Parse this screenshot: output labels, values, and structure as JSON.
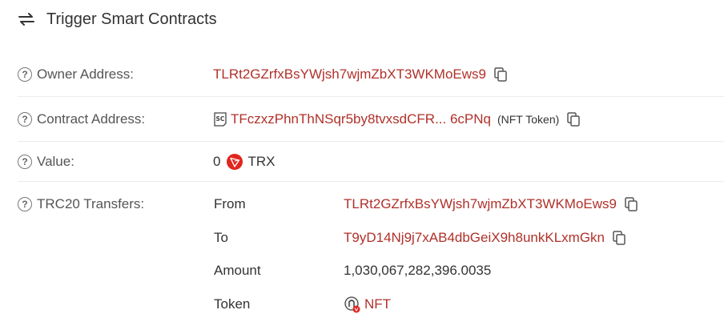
{
  "header": {
    "title": "Trigger Smart Contracts",
    "icon": "swap-arrows-icon"
  },
  "rows": {
    "owner": {
      "label": "Owner Address:",
      "value": "TLRt2GZrfxBsYWjsh7wjmZbXT3WKMoEws9"
    },
    "contract": {
      "label": "Contract Address:",
      "value": "TFczxzPhnThNSqr5by8tvxsdCFR... 6cPNq",
      "tag": "(NFT Token)"
    },
    "value": {
      "label": "Value:",
      "amount": "0",
      "unit": "TRX"
    },
    "trc20": {
      "label": "TRC20 Transfers:",
      "from_label": "From",
      "from_value": "TLRt2GZrfxBsYWjsh7wjmZbXT3WKMoEws9",
      "to_label": "To",
      "to_value": "T9yD14Nj9j7xAB4dbGeiX9h8unkKLxmGkn",
      "amount_label": "Amount",
      "amount_value": "1,030,067,282,396.0035",
      "token_label": "Token",
      "token_value": "NFT"
    }
  },
  "colors": {
    "link": "#b0312a",
    "trx": "#e0261f",
    "border": "#ececec"
  }
}
